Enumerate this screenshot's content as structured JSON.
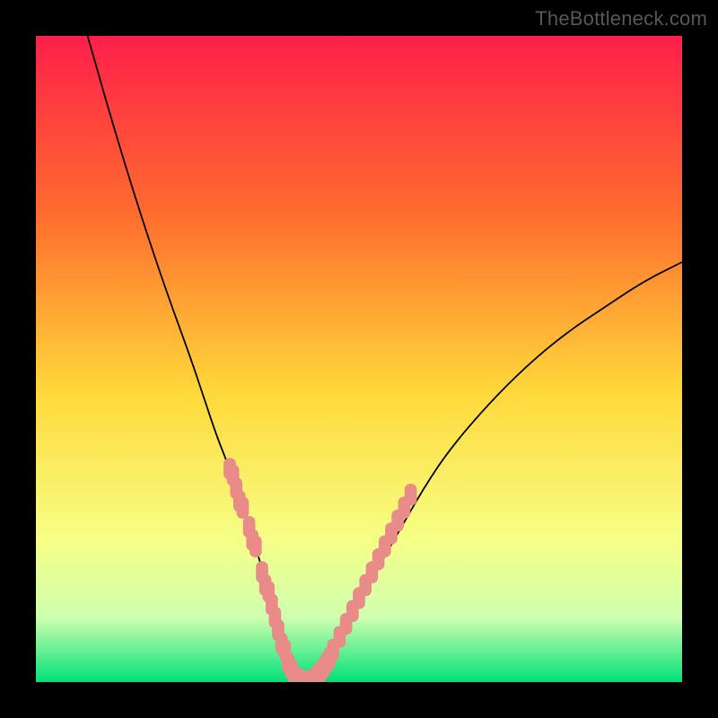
{
  "watermark": "TheBottleneck.com",
  "colors": {
    "bg_top": "#ff1f4b",
    "bg_upper_mid": "#ff8a2a",
    "bg_mid": "#ffe63a",
    "bg_lower_mid": "#f6ff86",
    "bg_near_bottom": "#cfffb0",
    "bg_bottom": "#00e07a",
    "curve": "#000000",
    "marker": "#e98b88",
    "frame": "#000000"
  },
  "chart_data": {
    "type": "line",
    "title": "",
    "xlabel": "",
    "ylabel": "",
    "xlim": [
      0,
      100
    ],
    "ylim": [
      0,
      100
    ],
    "series": [
      {
        "name": "bottleneck-curve",
        "x": [
          8,
          12,
          16,
          20,
          24,
          26,
          28,
          30,
          32,
          34,
          36,
          37,
          38,
          39,
          40,
          42,
          44,
          46,
          48,
          52,
          56,
          60,
          64,
          70,
          76,
          82,
          88,
          94,
          100
        ],
        "values": [
          100,
          86,
          73,
          61,
          50,
          44,
          38,
          33,
          27,
          21,
          14,
          10,
          6,
          3,
          1,
          0,
          1,
          4,
          8,
          16,
          23,
          30,
          36,
          43,
          49,
          54,
          58,
          62,
          65
        ]
      }
    ],
    "marker_clusters": [
      {
        "name": "left-cluster",
        "x": [
          30,
          30.5,
          31,
          31.5,
          32,
          33,
          33.5,
          34,
          35,
          35.5,
          36,
          36.5,
          37,
          37.5,
          38,
          38.5,
          39,
          39.5,
          40,
          40.5,
          41,
          41.5,
          42,
          42.5,
          43,
          43.5,
          44,
          44.5,
          45,
          45.5
        ],
        "values": [
          33,
          32,
          30,
          28,
          27,
          24,
          22,
          21,
          17,
          15,
          14,
          12,
          10,
          8,
          6,
          5,
          3,
          2,
          1,
          0.6,
          0.2,
          0.1,
          0.1,
          0.2,
          0.5,
          1,
          1.5,
          2.2,
          3,
          3.8
        ]
      },
      {
        "name": "right-cluster",
        "x": [
          46,
          47,
          48,
          49,
          50,
          51,
          52,
          53,
          54,
          55,
          56,
          57,
          58
        ],
        "values": [
          5,
          7,
          9,
          11,
          13,
          15,
          17,
          19,
          21,
          23,
          25,
          27,
          29
        ]
      }
    ],
    "background_gradient_stops": [
      {
        "offset": 0.0,
        "color": "#ff1f4b"
      },
      {
        "offset": 0.28,
        "color": "#ff6e2e"
      },
      {
        "offset": 0.55,
        "color": "#ffd83a"
      },
      {
        "offset": 0.78,
        "color": "#f6ff86"
      },
      {
        "offset": 0.9,
        "color": "#cfffb0"
      },
      {
        "offset": 1.0,
        "color": "#00e07a"
      }
    ]
  }
}
